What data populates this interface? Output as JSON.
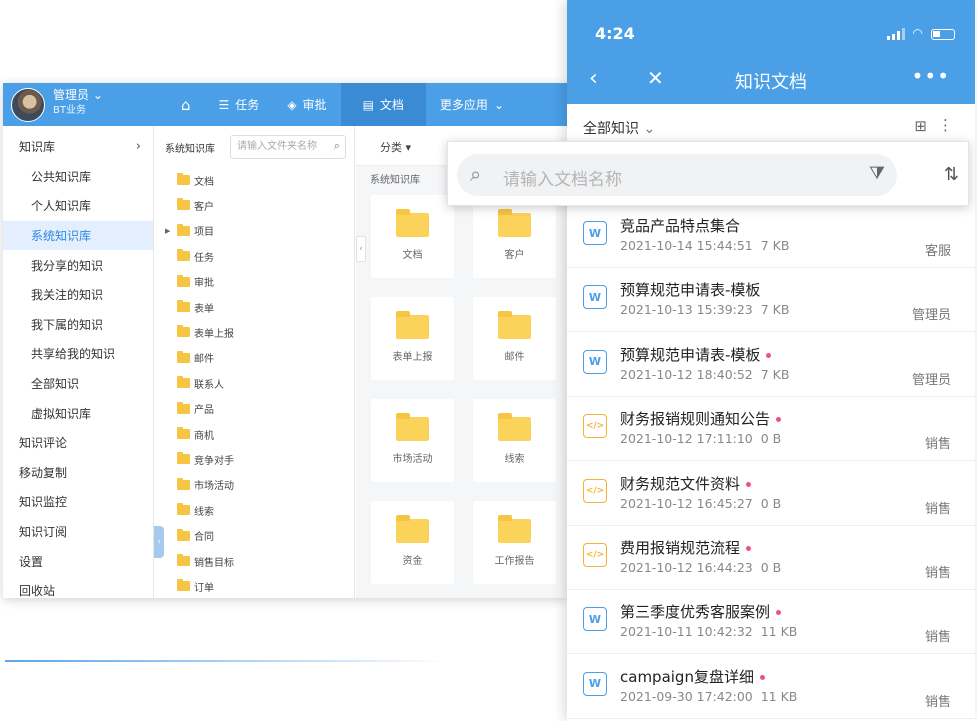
{
  "desktop": {
    "user": {
      "name": "管理员",
      "org": "BT业务"
    },
    "nav": [
      {
        "label": "",
        "icon": "home-icon"
      },
      {
        "label": "任务",
        "icon": "list-icon"
      },
      {
        "label": "审批",
        "icon": "stack-icon"
      },
      {
        "label": "文档",
        "icon": "doc-icon"
      },
      {
        "label": "更多应用",
        "icon": "chevron-down-icon"
      }
    ],
    "sidebar": [
      {
        "label": "知识库"
      },
      {
        "label": "公共知识库"
      },
      {
        "label": "个人知识库"
      },
      {
        "label": "系统知识库"
      },
      {
        "label": "我分享的知识"
      },
      {
        "label": "我关注的知识"
      },
      {
        "label": "我下属的知识"
      },
      {
        "label": "共享给我的知识"
      },
      {
        "label": "全部知识"
      },
      {
        "label": "虚拟知识库"
      },
      {
        "label": "知识评论"
      },
      {
        "label": "移动复制"
      },
      {
        "label": "知识监控"
      },
      {
        "label": "知识订阅"
      },
      {
        "label": "设置"
      },
      {
        "label": "回收站"
      }
    ],
    "tree": {
      "title": "系统知识库",
      "search_placeholder": "请输入文件夹名称",
      "nodes": [
        "文档",
        "客户",
        "项目",
        "任务",
        "审批",
        "表单",
        "表单上报",
        "邮件",
        "联系人",
        "产品",
        "商机",
        "竞争对手",
        "市场活动",
        "线索",
        "合同",
        "销售目标",
        "订单"
      ]
    },
    "content": {
      "category_label": "分类 ▾",
      "path_title": "系统知识库",
      "tiles": [
        "文档",
        "客户",
        "表单上报",
        "邮件",
        "市场活动",
        "线索",
        "资金",
        "工作报告"
      ]
    }
  },
  "mobile": {
    "time": "4:24",
    "title": "知识文档",
    "filter_label": "全部知识",
    "search_placeholder": "请输入文档名称",
    "docs": [
      {
        "title": "竞品产品特点集合",
        "date": "2021-10-14 15:44:51",
        "size": "7 KB",
        "owner": "客服",
        "type": "W",
        "new": false
      },
      {
        "title": "预算规范申请表-模板",
        "date": "2021-10-13 15:39:23",
        "size": "7 KB",
        "owner": "管理员",
        "type": "W",
        "new": false
      },
      {
        "title": "预算规范申请表-模板",
        "date": "2021-10-12 18:40:52",
        "size": "7 KB",
        "owner": "管理员",
        "type": "W",
        "new": true
      },
      {
        "title": "财务报销规则通知公告",
        "date": "2021-10-12 17:11:10",
        "size": "0 B",
        "owner": "销售",
        "type": "</>",
        "new": true
      },
      {
        "title": "财务规范文件资料",
        "date": "2021-10-12 16:45:27",
        "size": "0 B",
        "owner": "销售",
        "type": "</>",
        "new": true
      },
      {
        "title": "费用报销规范流程",
        "date": "2021-10-12 16:44:23",
        "size": "0 B",
        "owner": "销售",
        "type": "</>",
        "new": true
      },
      {
        "title": "第三季度优秀客服案例",
        "date": "2021-10-11 10:42:32",
        "size": "11 KB",
        "owner": "销售",
        "type": "W",
        "new": true
      },
      {
        "title": "campaign复盘详细",
        "date": "2021-09-30 17:42:00",
        "size": "11 KB",
        "owner": "销售",
        "type": "W",
        "new": true
      }
    ]
  }
}
